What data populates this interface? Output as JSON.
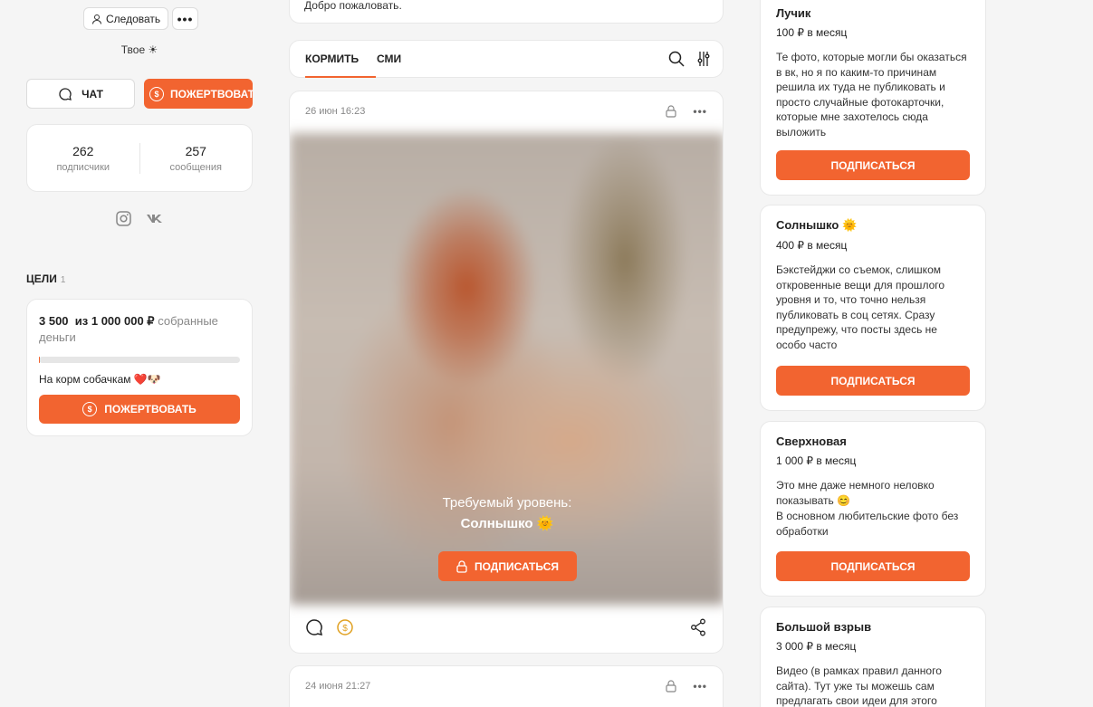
{
  "profile": {
    "follow_label": "Следовать",
    "more_label": "•••",
    "tagline": "Твое ☀",
    "chat_label": "ЧАТ",
    "donate_label": "ПОЖЕРТВОВАТЬ",
    "stats": [
      {
        "value": "262",
        "label": "подписчики"
      },
      {
        "value": "257",
        "label": "сообщения"
      }
    ],
    "socials": [
      "instagram-icon",
      "vk-icon"
    ]
  },
  "goals": {
    "title": "ЦЕЛИ",
    "count": "1",
    "collected": "3 500",
    "of_total": "из 1 000 000 ₽",
    "suffix": "собранные деньги",
    "progress": 0.0035,
    "name": "На корм собачкам ❤️🐶",
    "donate_label": "ПОЖЕРТВОВАТЬ"
  },
  "feed": {
    "welcome": "Добро пожаловать.",
    "tabs": [
      {
        "label": "КОРМИТЬ"
      },
      {
        "label": "СМИ"
      }
    ],
    "active_tab": 0,
    "post": {
      "date": "26 июн 16:23",
      "required_label": "Требуемый уровень:",
      "required_tier": "Солнышко 🌞",
      "subscribe_label": "ПОДПИСАТЬСЯ"
    },
    "post2": {
      "date": "24 июня 21:27"
    }
  },
  "tiers": [
    {
      "name": "Лучик",
      "price": "100 ₽ в месяц",
      "description": "Те фото, которые могли бы оказаться в вк, но я по каким-то причинам решила их туда не публиковать и просто случайные фотокарточки, которые мне захотелось сюда выложить",
      "button": "ПОДПИСАТЬСЯ"
    },
    {
      "name": "Солнышко 🌞",
      "price": "400 ₽ в месяц",
      "description": "Бэкстейджи со съемок, слишком откровенные вещи для прошлого уровня и то, что точно нельзя публиковать в соц сетях. Сразу предупрежу, что посты здесь не особо часто",
      "button": "ПОДПИСАТЬСЯ"
    },
    {
      "name": "Сверхновая",
      "price": "1 000 ₽ в месяц",
      "description": "Это мне даже немного неловко показывать 😊",
      "description2": "В основном любительские фото без обработки",
      "button": "ПОДПИСАТЬСЯ"
    },
    {
      "name": "Большой взрыв",
      "price": "3 000 ₽ в месяц",
      "description": "Видео (в рамках правил данного сайта). Тут уже ты можешь сам предлагать свои идеи для этого"
    }
  ],
  "colors": {
    "accent": "#f26430",
    "background": "#f5f5f5"
  }
}
